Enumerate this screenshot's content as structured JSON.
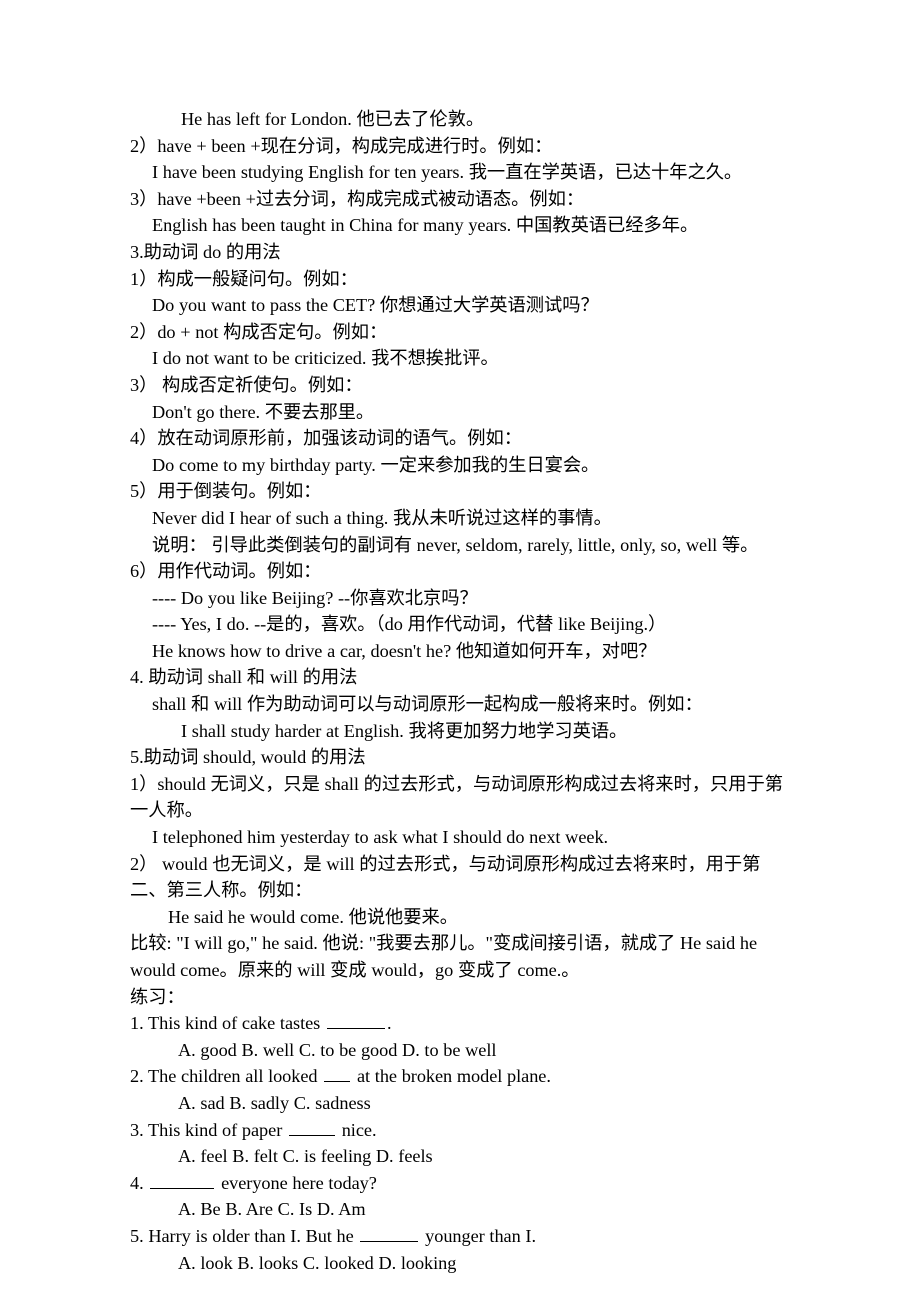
{
  "document": {
    "type": "study-notes",
    "language": "zh-CN + en",
    "topic": "助动词的用法",
    "background_color": "#ffffff",
    "text_color": "#000000"
  },
  "lines": {
    "l01": "He has left for London.    他已去了伦敦。",
    "l02": "2）have + been +现在分词，构成完成进行时。例如：",
    "l03": "I have been studying English for ten years. 我一直在学英语，已达十年之久。",
    "l04": "3）have +been +过去分词，构成完成式被动语态。例如：",
    "l05": "English has been taught in China for many years. 中国教英语已经多年。",
    "l06": "3.助动词 do  的用法",
    "l07": "1）构成一般疑问句。例如：",
    "l08": "Do you want to pass the CET?    你想通过大学英语测试吗？",
    "l09": "2）do + not  构成否定句。例如：",
    "l10": "I do not want to be criticized.      我不想挨批评。",
    "l11": "3）  构成否定祈使句。例如：",
    "l12": "Don't go there.    不要去那里。",
    "l13": "4）放在动词原形前，加强该动词的语气。例如：",
    "l14": "Do come to my birthday party.    一定来参加我的生日宴会。",
    "l15": "5）用于倒装句。例如：",
    "l16": "Never did I hear of such a thing.      我从未听说过这样的事情。",
    "l17": "说明：   引导此类倒装句的副词有 never, seldom, rarely, little, only, so, well 等。",
    "l18": "6）用作代动词。例如：",
    "l19": "---- Do you like Beijing?    --你喜欢北京吗？",
    "l20": "---- Yes, I do.    --是的，喜欢。（do 用作代动词，代替 like Beijing.）",
    "l21": "He knows how to drive a car, doesn't he?  他知道如何开车，对吧？",
    "l22": "4. 助动词 shall 和 will 的用法",
    "l23": "shall 和 will 作为助动词可以与动词原形一起构成一般将来时。例如：",
    "l24": "I shall study harder at English.      我将更加努力地学习英语。",
    "l25": "5.助动词 should, would 的用法",
    "l26": "1）should 无词义，只是 shall 的过去形式，与动词原形构成过去将来时，只用于第一人称。",
    "l27": "I telephoned him yesterday to ask what I should do next week.",
    "l28": "2）  would 也无词义，是 will 的过去形式，与动词原形构成过去将来时，用于第二、第三人称。例如：",
    "l29": "He said he would come.    他说他要来。",
    "l30": "比较: \"I will go,\" he said. 他说: \"我要去那儿。\"变成间接引语，就成了 He said he would come。原来的 will 变成 would，go 变成了 come.。",
    "l31": "练习："
  },
  "exercises": [
    {
      "number": "1.",
      "stem_before": "This kind of cake tastes",
      "blank": "b-md",
      "stem_after": ".",
      "options": "A. good B. well C. to be good D. to be well"
    },
    {
      "number": "2.",
      "stem_before": "The children all looked",
      "blank": "b-xs",
      "stem_after": "at the broken model plane.",
      "options": "A. sad   B. sadly C. sadness"
    },
    {
      "number": "3.",
      "stem_before": "This kind of paper",
      "blank": "b-sm",
      "stem_after": "nice.",
      "options": "A. feel B. felt C. is feeling D. feels"
    },
    {
      "number": "4.",
      "stem_before": "",
      "blank": "b-lg",
      "stem_after": "everyone here today?",
      "options": "A. Be B. Are C. Is D. Am"
    },
    {
      "number": "5.",
      "stem_before": "Harry is older than I. But he",
      "blank": "b-md",
      "stem_after": "younger than I.",
      "options": "A. look B. looks C. looked D. looking"
    }
  ]
}
